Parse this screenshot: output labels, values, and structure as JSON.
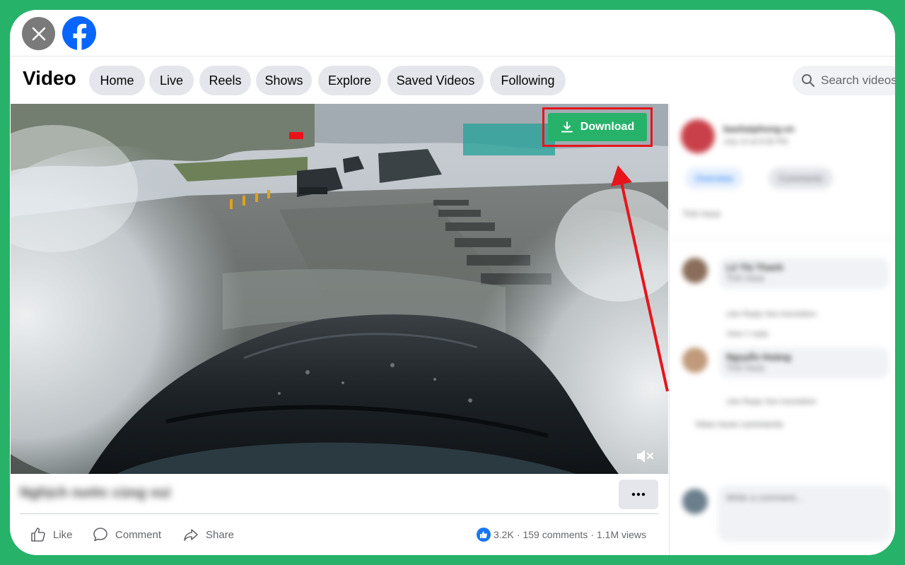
{
  "header": {
    "close_icon": "close-icon",
    "logo": "facebook-logo"
  },
  "nav": {
    "title": "Video",
    "tabs": [
      {
        "label": "Home"
      },
      {
        "label": "Live"
      },
      {
        "label": "Reels"
      },
      {
        "label": "Shows"
      },
      {
        "label": "Explore"
      },
      {
        "label": "Saved Videos"
      },
      {
        "label": "Following"
      }
    ],
    "search_placeholder": "Search videos"
  },
  "video": {
    "download_label": "Download",
    "annotation_color": "#e8141c",
    "accent_color": "#27b26a",
    "caption": "Nghịch nước cùng vui"
  },
  "actions": {
    "like": "Like",
    "comment": "Comment",
    "share": "Share"
  },
  "stats": {
    "reactions": "3.2K",
    "comments": "159 comments",
    "separator": "·",
    "views": "1.1M views"
  },
  "side_panel": {
    "page_name": "baohaiphong.vn",
    "date": "July 13 at 8:08 PM",
    "tab_overview": "Overview",
    "tab_comments": "Comments",
    "post_text": "Trời mưa",
    "comments": [
      {
        "name": "Lê Thị Thanh",
        "text": "Trời mưa",
        "actions": "Like  Reply  See translation",
        "replies": "View 1 reply"
      },
      {
        "name": "Nguyễn Hoàng",
        "text": "Trời mưa",
        "actions": "Like  Reply  See translation"
      }
    ],
    "more_comments": "View more comments",
    "write_placeholder": "Write a comment..."
  }
}
